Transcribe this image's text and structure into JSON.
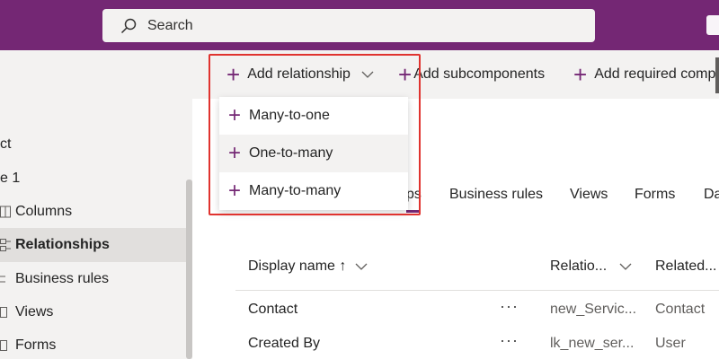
{
  "search": {
    "placeholder": "Search"
  },
  "leftnav": {
    "frag1": "ct",
    "frag2": "e 1",
    "items": [
      {
        "label": "Columns",
        "icon": "columns-icon",
        "selected": false
      },
      {
        "label": "Relationships",
        "icon": "relationships-icon",
        "selected": true
      },
      {
        "label": "Business rules",
        "icon": "business-rules-icon",
        "selected": false
      },
      {
        "label": "Views",
        "icon": "views-icon",
        "selected": false
      },
      {
        "label": "Forms",
        "icon": "forms-icon",
        "selected": false
      }
    ]
  },
  "commandbar": {
    "add_relationship": "Add relationship",
    "add_subcomponents": "Add subcomponents",
    "add_required": "Add required comp"
  },
  "dropdown": {
    "items": [
      {
        "label": "Many-to-one"
      },
      {
        "label": "One-to-many",
        "hovered": true
      },
      {
        "label": "Many-to-many"
      }
    ]
  },
  "tabs": [
    "ps",
    "Business rules",
    "Views",
    "Forms",
    "Da"
  ],
  "table": {
    "headers": [
      "Display name ↑",
      "Relatio...",
      "Related..."
    ],
    "rows": [
      {
        "display_name": "Contact",
        "relationship": "new_Servic...",
        "related": "Contact",
        "more": "···"
      },
      {
        "display_name": "Created By",
        "relationship": "lk_new_ser...",
        "related": "User",
        "more": "···"
      }
    ]
  },
  "colors": {
    "brand": "#742774",
    "highlight": "#e0332f",
    "nav_bg": "#f3f2f1"
  }
}
